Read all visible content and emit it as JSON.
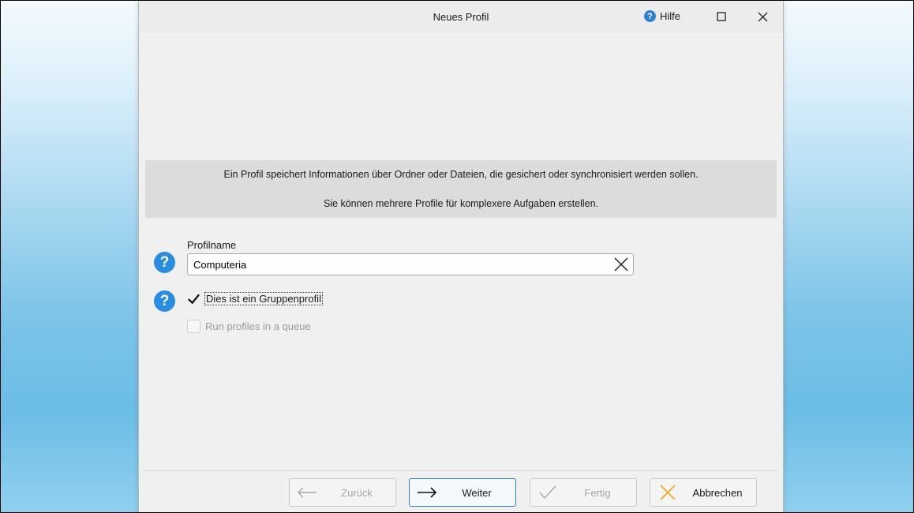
{
  "window": {
    "title": "Neues Profil",
    "help_label": "Hilfe",
    "help_icon_glyph": "?"
  },
  "info": {
    "line1": "Ein Profil speichert Informationen über Ordner oder Dateien, die gesichert oder synchronisiert werden sollen.",
    "line2": "Sie können mehrere Profile für komplexere Aufgaben erstellen."
  },
  "form": {
    "help_glyph": "?",
    "profile_name_label": "Profilname",
    "profile_name_value": "Computeria",
    "group_profile_label": "Dies ist ein Gruppenprofil",
    "group_profile_checked": true,
    "queue_label": "Run profiles in a queue",
    "queue_checked": false,
    "queue_enabled": false
  },
  "buttons": {
    "back": "Zurück",
    "next": "Weiter",
    "finish": "Fertig",
    "cancel": "Abbrechen"
  },
  "colors": {
    "accent_blue": "#2b8ce0",
    "cancel_x": "#f5a623",
    "background_gradient_bottom": "#6bbde5"
  }
}
